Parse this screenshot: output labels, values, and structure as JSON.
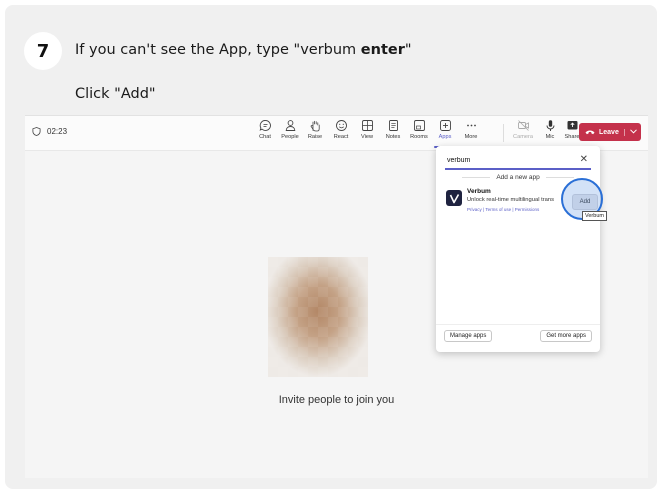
{
  "instruction": {
    "step_number": "7",
    "line1_prefix": "If you can't see the App, type \"verbum ",
    "line1_bold": "enter",
    "line1_suffix": "\"",
    "line2": "Click \"Add\""
  },
  "meeting": {
    "timer": "02:23",
    "toolbar": [
      {
        "key": "chat",
        "label": "Chat",
        "icon": "chat-icon"
      },
      {
        "key": "people",
        "label": "People",
        "icon": "people-icon"
      },
      {
        "key": "raise",
        "label": "Raise",
        "icon": "raise-hand-icon"
      },
      {
        "key": "react",
        "label": "React",
        "icon": "react-icon"
      },
      {
        "key": "view",
        "label": "View",
        "icon": "view-icon"
      },
      {
        "key": "notes",
        "label": "Notes",
        "icon": "notes-icon"
      },
      {
        "key": "rooms",
        "label": "Rooms",
        "icon": "rooms-icon"
      },
      {
        "key": "apps",
        "label": "Apps",
        "icon": "apps-icon"
      },
      {
        "key": "more",
        "label": "More",
        "icon": "more-icon"
      },
      {
        "key": "camera",
        "label": "Camera",
        "icon": "camera-icon"
      },
      {
        "key": "mic",
        "label": "Mic",
        "icon": "mic-icon"
      },
      {
        "key": "share",
        "label": "Share",
        "icon": "share-icon"
      }
    ],
    "leave_label": "Leave",
    "invite_text": "Invite people to join you",
    "accent_color": "#5b5fc7",
    "leave_color": "#c4314b"
  },
  "apps_panel": {
    "search_value": "verbum",
    "section_header": "Add a new app",
    "app": {
      "name": "Verbum",
      "description": "Unlock real-time multilingual trans",
      "links": "Privacy | Terms of use | Permissions",
      "add_label": "Add"
    },
    "tooltip": "Verbum",
    "manage_label": "Manage apps",
    "get_more_label": "Get more apps"
  }
}
